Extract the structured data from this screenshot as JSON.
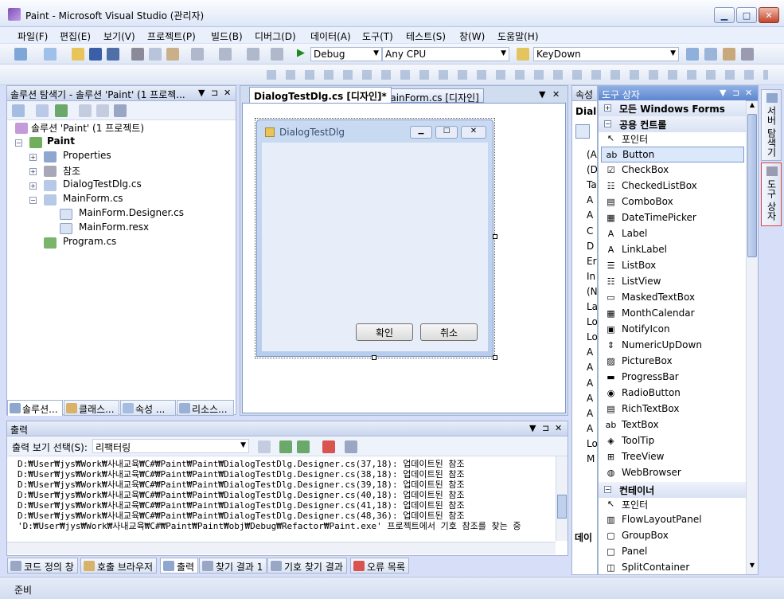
{
  "window": {
    "title": "Paint - Microsoft Visual Studio (관리자)",
    "min": "▁",
    "max": "□",
    "close": "✕"
  },
  "menu": [
    "파일(F)",
    "편집(E)",
    "보기(V)",
    "프로젝트(P)",
    "빌드(B)",
    "디버그(D)",
    "데이터(A)",
    "도구(T)",
    "테스트(S)",
    "창(W)",
    "도움말(H)"
  ],
  "toolbar": {
    "config": "Debug",
    "platform": "Any CPU",
    "find": "KeyDown"
  },
  "solution_explorer": {
    "title": "솔루션 탐색기 - 솔루션 'Paint' (1 프로젝...",
    "solution": "솔루션 'Paint' (1 프로젝트)",
    "project": "Paint",
    "items": [
      "Properties",
      "참조",
      "DialogTestDlg.cs",
      "MainForm.cs",
      "MainForm.Designer.cs",
      "MainForm.resx",
      "Program.cs"
    ]
  },
  "left_tabs": [
    "솔루션...",
    "클래스...",
    "속성 ...",
    "리소스..."
  ],
  "doc_tabs": {
    "active": "DialogTestDlg.cs [디자인]*",
    "inactive": "MainForm.cs [디자인]"
  },
  "designer": {
    "form_title": "DialogTestDlg",
    "ok": "확인",
    "cancel": "취소"
  },
  "properties_panel": {
    "title": "속성",
    "header": "Dial",
    "rows": [
      "(A",
      "(D",
      "Ta",
      "A",
      "A",
      "C",
      "D",
      "Er",
      "In",
      "(N",
      "La",
      "Lo",
      "Lo",
      "A",
      "A",
      "A",
      "A",
      "A",
      "A",
      "Lo",
      "M"
    ],
    "footer": "데이"
  },
  "toolbox": {
    "title": "도구 상자",
    "groups": {
      "all": "모든 Windows Forms",
      "common": "공용 컨트롤",
      "containers": "컨테이너"
    },
    "common_items": [
      "포인터",
      "Button",
      "CheckBox",
      "CheckedListBox",
      "ComboBox",
      "DateTimePicker",
      "Label",
      "LinkLabel",
      "ListBox",
      "ListView",
      "MaskedTextBox",
      "MonthCalendar",
      "NotifyIcon",
      "NumericUpDown",
      "PictureBox",
      "ProgressBar",
      "RadioButton",
      "RichTextBox",
      "TextBox",
      "ToolTip",
      "TreeView",
      "WebBrowser"
    ],
    "container_items": [
      "포인터",
      "FlowLayoutPanel",
      "GroupBox",
      "Panel",
      "SplitContainer"
    ]
  },
  "side_tabs": {
    "server": "서버 탐색기",
    "toolbox": "도구 상자"
  },
  "output": {
    "title": "출력",
    "source_label": "출력 보기 선택(S):",
    "source_value": "리팩터링",
    "lines": [
      "D:₩User₩jys₩Work₩사내교육₩C#₩Paint₩Paint₩DialogTestDlg.Designer.cs(37,18): 업데이트된 참조",
      "D:₩User₩jys₩Work₩사내교육₩C#₩Paint₩Paint₩DialogTestDlg.Designer.cs(38,18): 업데이트된 참조",
      "D:₩User₩jys₩Work₩사내교육₩C#₩Paint₩Paint₩DialogTestDlg.Designer.cs(39,18): 업데이트된 참조",
      "D:₩User₩jys₩Work₩사내교육₩C#₩Paint₩Paint₩DialogTestDlg.Designer.cs(40,18): 업데이트된 참조",
      "D:₩User₩jys₩Work₩사내교육₩C#₩Paint₩Paint₩DialogTestDlg.Designer.cs(41,18): 업데이트된 참조",
      "D:₩User₩jys₩Work₩사내교육₩C#₩Paint₩Paint₩DialogTestDlg.Designer.cs(48,36): 업데이트된 참조",
      "'D:₩User₩jys₩Work₩사내교육₩C#₩Paint₩Paint₩obj₩Debug₩Refactor₩Paint.exe' 프로젝트에서 기호 참조를 찾는 중"
    ]
  },
  "bottom_tabs": [
    "코드 정의 창",
    "호출 브라우저",
    "출력",
    "찾기 결과 1",
    "기호 찾기 결과",
    "오류 목록"
  ],
  "status": "준비"
}
